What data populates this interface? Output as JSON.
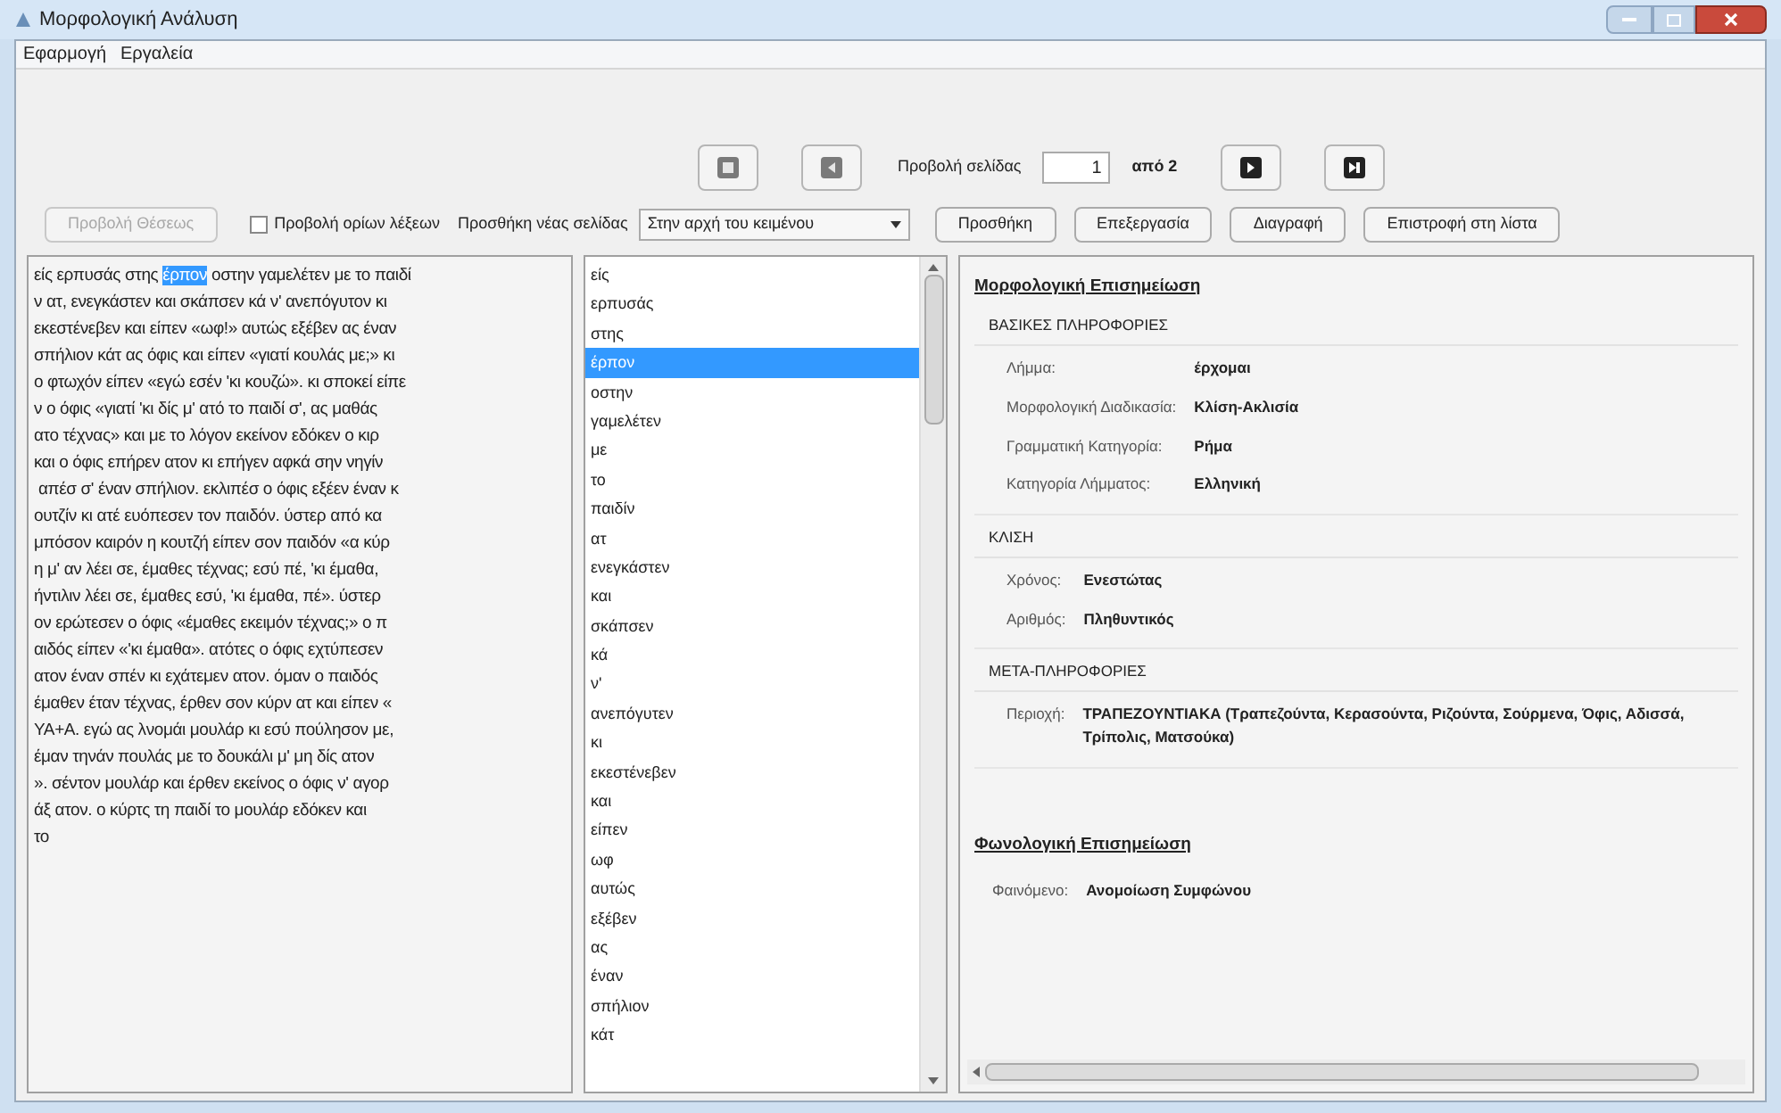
{
  "window": {
    "title": "Μορφολογική Ανάλυση"
  },
  "menu": [
    "Εφαρμογή",
    "Εργαλεία"
  ],
  "pager": {
    "label": "Προβολή σελίδας",
    "page": "1",
    "of": "από 2"
  },
  "toolbar": {
    "show_button": {
      "label": "Προβολή Θέσεως",
      "disabled": true
    },
    "checkbox": {
      "label": "Προβολή ορίων λέξεων",
      "checked": false
    },
    "add_label": "Προσθήκη νέας σελίδας",
    "position": "Στην αρχή του κειμένου",
    "buttons": [
      "Προσθήκη",
      "Επεξεργασία",
      "Διαγραφή",
      "Επιστροφή στη λίστα"
    ]
  },
  "text": {
    "first_line": {
      "before": "είς ερπυσάς στης ",
      "selected": "έρπον",
      "after": " οστην γαμελέτεν με το παιδί"
    },
    "lines": [
      "ν ατ, ενεγκάστεν και σκάπσεν κά ν' ανεπόγυτον κι",
      "εκεστένεβεν και είπεν «ωφ!» αυτώς εξέβεν ας έναν",
      "σπήλιον κάτ ας όφις και είπεν «γιατί κουλάς με;» κι",
      "ο φτωχόν είπεν «εγώ εσέν 'κι κουζώ». κι σποκεί είπε",
      "ν ο όφις «γιατί 'κι δίς μ' ατό το παιδί σ', ας μαθάς",
      "ατο τέχνας» και με το λόγον εκείνον εδόκεν ο κιρ",
      "και ο όφις επήρεν ατον κι επήγεν αφκά σην νηγίν",
      " απέσ σ' έναν σπήλιον. εκλιπέσ ο όφις εξέεν έναν κ",
      "ουτζίν κι ατέ ευόπεσεν τον παιδόν. ύστερ από κα",
      "μπόσον καιρόν η κουτζή είπεν σον παιδόν «α κύρ",
      "η μ' αν λέει σε, έμαθες τέχνας; εσύ πέ, 'κι έμαθα,",
      "ήντιλιν λέει σε, έμαθες εσύ, 'κι έμαθα, πέ». ύστερ",
      "ον ερώτεσεν ο όφις «έμαθες εκειμόν τέχνας;» ο π",
      "αιδός είπεν «'κι έμαθα». ατότες ο όφις εχτύπεσεν",
      "ατον έναν σπέν κι εχάτεμεν ατον. όμαν ο παιδός",
      "έμαθεν έταν τέχνας, έρθεν σον κύρν ατ και είπεν «",
      "ΥΑ+Α. εγώ ας λνομάι μουλάρ κι εσύ πούλησον με,",
      "έμαν τηνάν πουλάς με το δουκάλι μ' μη δίς ατον",
      "». σέντον μουλάρ και έρθεν εκείνος ο όφις ν' αγορ",
      "άξ ατον. ο κύρτς τη παιδί το μουλάρ εδόκεν και",
      "το"
    ]
  },
  "words": [
    {
      "label": "είς",
      "selected": false
    },
    {
      "label": "ερπυσάς",
      "selected": false
    },
    {
      "label": "στης",
      "selected": false
    },
    {
      "label": "έρπον",
      "selected": true
    },
    {
      "label": "οστην",
      "selected": false
    },
    {
      "label": "γαμελέτεν",
      "selected": false
    },
    {
      "label": "με",
      "selected": false
    },
    {
      "label": "το",
      "selected": false
    },
    {
      "label": "παιδίν",
      "selected": false
    },
    {
      "label": "ατ",
      "selected": false
    },
    {
      "label": "ενεγκάστεν",
      "selected": false
    },
    {
      "label": "και",
      "selected": false
    },
    {
      "label": "σκάπσεν",
      "selected": false
    },
    {
      "label": "κά",
      "selected": false
    },
    {
      "label": "ν'",
      "selected": false
    },
    {
      "label": "ανεπόγυτεν",
      "selected": false
    },
    {
      "label": "κι",
      "selected": false
    },
    {
      "label": "εκεστένεβεν",
      "selected": false
    },
    {
      "label": "και",
      "selected": false
    },
    {
      "label": "είπεν",
      "selected": false
    },
    {
      "label": "ωφ",
      "selected": false
    },
    {
      "label": "αυτώς",
      "selected": false
    },
    {
      "label": "εξέβεν",
      "selected": false
    },
    {
      "label": "ας",
      "selected": false
    },
    {
      "label": "έναν",
      "selected": false
    },
    {
      "label": "σπήλιον",
      "selected": false
    },
    {
      "label": "κάτ",
      "selected": false
    }
  ],
  "annotation": {
    "title": "Μορφολογική Επισημείωση",
    "sections": [
      {
        "heading": "ΒΑΣΙΚΕΣ ΠΛΗΡΟΦΟΡΙΕΣ",
        "rows": [
          {
            "label": "Λήμμα:",
            "value": "έρχομαι"
          },
          {
            "label": "Μορφολογική Διαδικασία:",
            "value": "Κλίση-Ακλισία"
          },
          {
            "label": "Γραμματική Κατηγορία:",
            "value": "Ρήμα"
          },
          {
            "label": "Κατηγορία Λήμματος:",
            "value": "Ελληνική"
          }
        ]
      },
      {
        "heading": "ΚΛΙΣΗ",
        "rows": [
          {
            "label": "Χρόνος:",
            "value": "Ενεστώτας"
          },
          {
            "label": "Αριθμός:",
            "value": "Πληθυντικός"
          }
        ]
      },
      {
        "heading": "ΜΕΤΑ-ΠΛΗΡΟΦΟΡΙΕΣ",
        "rows": [
          {
            "label": "Περιοχή:",
            "value": "ΤΡΑΠΕΖΟΥΝΤΙΑΚΑ (Τραπεζούντα, Κερασούντα, Ριζούντα, Σούρμενα, Όφις, Αδισσά, Τρίπολις, Ματσούκα)"
          }
        ]
      }
    ],
    "phonology_title": "Φωνολογική Επισημείωση",
    "phonology_rows": [
      {
        "label": "Φαινόμενο:",
        "value": "Ανομοίωση Συμφώνου"
      }
    ]
  }
}
